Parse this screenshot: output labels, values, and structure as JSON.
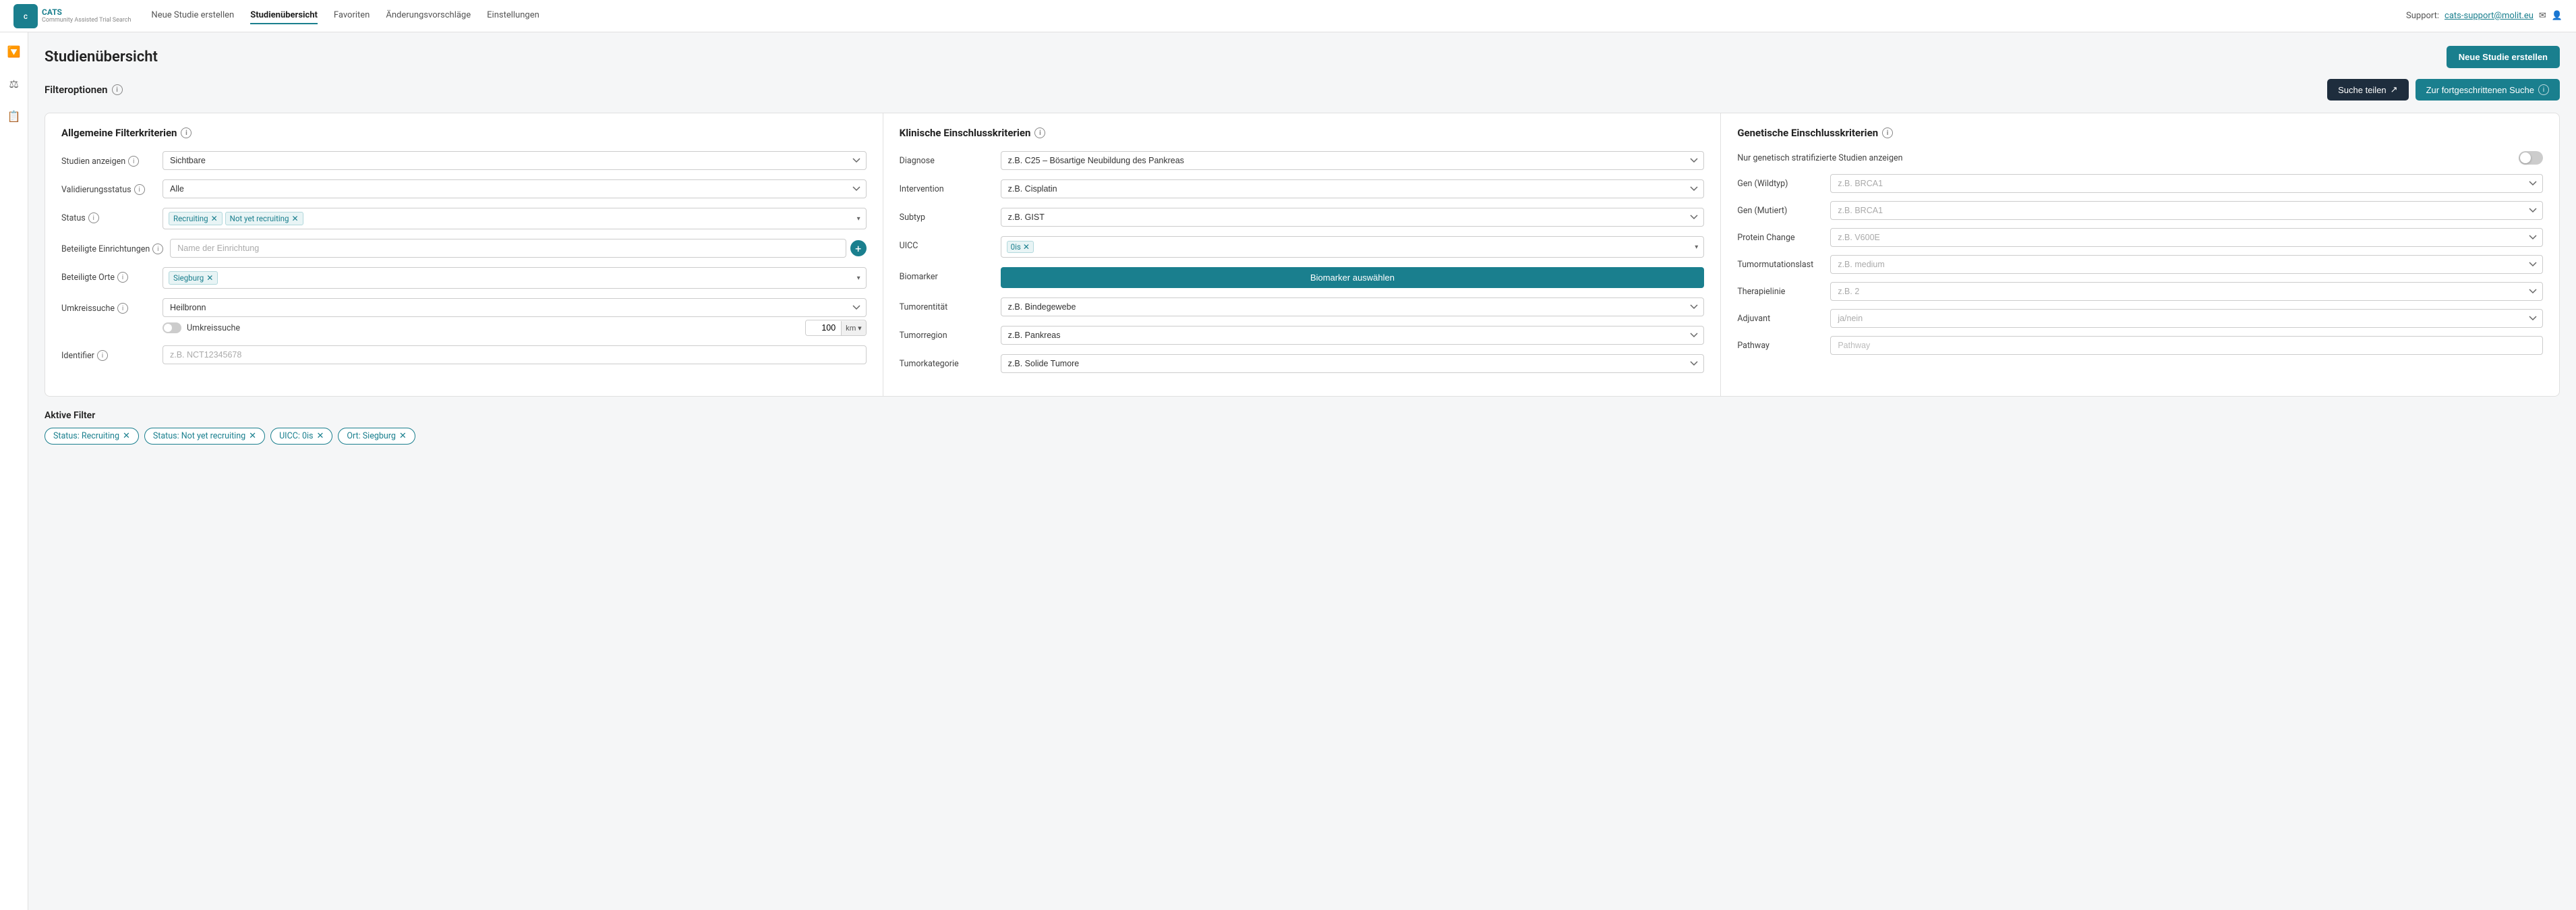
{
  "app": {
    "logo_line1": "CATS",
    "logo_line2": "Community Assisted Trial Search",
    "support_label": "Support:",
    "support_email": "cats-support@molit.eu"
  },
  "nav": {
    "items": [
      {
        "id": "neue-studie",
        "label": "Neue Studie erstellen"
      },
      {
        "id": "studienuebersicht",
        "label": "Studienübersicht",
        "active": true
      },
      {
        "id": "favoriten",
        "label": "Favoriten"
      },
      {
        "id": "aenderungsvorschlaege",
        "label": "Änderungsvorschläge"
      },
      {
        "id": "einstellungen",
        "label": "Einstellungen"
      }
    ]
  },
  "page": {
    "title": "Studienübersicht",
    "neue_studie_btn": "Neue Studie erstellen"
  },
  "filter_options": {
    "label": "Filteroptionen",
    "suche_teilen_btn": "Suche teilen",
    "fortgeschritten_btn": "Zur fortgeschrittenen Suche"
  },
  "allgemeine": {
    "title": "Allgemeine Filterkriterien",
    "studien_anzeigen_label": "Studien anzeigen",
    "studien_anzeigen_value": "Sichtbare",
    "validierungsstatus_label": "Validierungsstatus",
    "validierungsstatus_value": "Alle",
    "status_label": "Status",
    "status_tags": [
      {
        "id": "recruiting",
        "label": "Recruiting"
      },
      {
        "id": "not-yet-recruiting",
        "label": "Not yet recruiting"
      }
    ],
    "beteiligte_einrichtungen_label": "Beteiligte Einrichtungen",
    "beteiligte_einrichtungen_placeholder": "Name der Einrichtung",
    "beteiligte_orte_label": "Beteiligte Orte",
    "beteiligte_orte_tags": [
      {
        "id": "siegburg",
        "label": "Siegburg"
      }
    ],
    "umkreissuche_label": "Umkreissuche",
    "umkreissuche_field_label": "Umkreissuche",
    "umkreissuche_placeholder": "Heilbronn",
    "umkreissuche_km_value": "100km",
    "identifier_label": "Identifier",
    "identifier_placeholder": "z.B. NCT12345678"
  },
  "klinische": {
    "title": "Klinische Einschlusskriterien",
    "diagnose_label": "Diagnose",
    "diagnose_placeholder": "z.B. C25 – Bösartige Neubildung des Pankreas",
    "intervention_label": "Intervention",
    "intervention_placeholder": "z.B. Cisplatin",
    "subtyp_label": "Subtyp",
    "subtyp_placeholder": "z.B. GIST",
    "uicc_label": "UICC",
    "uicc_tags": [
      {
        "id": "0is",
        "label": "0is"
      }
    ],
    "biomarker_label": "Biomarker",
    "biomarker_btn": "Biomarker auswählen",
    "tumorentitaet_label": "Tumorentität",
    "tumorentitaet_placeholder": "z.B. Bindegewebe",
    "tumorregion_label": "Tumorregion",
    "tumorregion_placeholder": "z.B. Pankreas",
    "tumorkategorie_label": "Tumorkategorie",
    "tumorkategorie_placeholder": "z.B. Solide Tumore"
  },
  "genetische": {
    "title": "Genetische Einschlusskriterien",
    "nur_genetisch_label": "Nur genetisch stratifizierte Studien anzeigen",
    "gen_wildtyp_label": "Gen (Wildtyp)",
    "gen_wildtyp_placeholder": "z.B. BRCA1",
    "gen_mutiert_label": "Gen (Mutiert)",
    "gen_mutiert_placeholder": "z.B. BRCA1",
    "protein_change_label": "Protein Change",
    "protein_change_placeholder": "z.B. V600E",
    "tumormutationslast_label": "Tumormutationslast",
    "tumormutationslast_placeholder": "z.B. medium",
    "therapielinie_label": "Therapielinie",
    "therapielinie_placeholder": "z.B. 2",
    "adjuvant_label": "Adjuvant",
    "adjuvant_placeholder": "ja/nein",
    "pathway_label": "Pathway",
    "pathway_placeholder": "Pathway"
  },
  "aktive_filter": {
    "title": "Aktive Filter",
    "tags": [
      {
        "id": "status-recruiting",
        "label": "Status: Recruiting"
      },
      {
        "id": "status-not-yet-recruiting",
        "label": "Status: Not yet recruiting"
      },
      {
        "id": "uicc-0is",
        "label": "UICC: 0is"
      },
      {
        "id": "ort-siegburg",
        "label": "Ort: Siegburg"
      }
    ]
  },
  "sidebar": {
    "icons": [
      {
        "id": "filter-icon",
        "symbol": "⚡"
      },
      {
        "id": "settings-icon",
        "symbol": "⚙"
      },
      {
        "id": "list-icon",
        "symbol": "☰"
      }
    ]
  }
}
